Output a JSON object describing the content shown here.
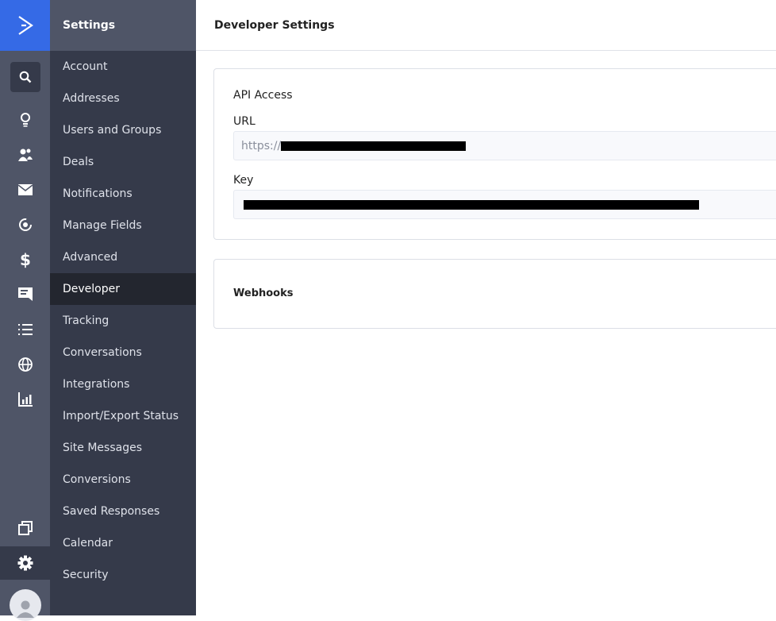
{
  "rail": {
    "icons": [
      "logo-icon",
      "search-icon",
      "lightbulb-icon",
      "contacts-icon",
      "email-icon",
      "automation-icon",
      "dollar-icon",
      "conversations-icon",
      "list-icon",
      "globe-icon",
      "reports-icon",
      "pages-icon",
      "gear-icon",
      "avatar-icon"
    ],
    "accent": "#356ae6"
  },
  "sidebar": {
    "title": "Settings",
    "active": "Developer",
    "items": [
      {
        "label": "Account"
      },
      {
        "label": "Addresses"
      },
      {
        "label": "Users and Groups"
      },
      {
        "label": "Deals"
      },
      {
        "label": "Notifications"
      },
      {
        "label": "Manage Fields"
      },
      {
        "label": "Advanced"
      },
      {
        "label": "Developer"
      },
      {
        "label": "Tracking"
      },
      {
        "label": "Conversations"
      },
      {
        "label": "Integrations"
      },
      {
        "label": "Import/Export Status"
      },
      {
        "label": "Site Messages"
      },
      {
        "label": "Conversions"
      },
      {
        "label": "Saved Responses"
      },
      {
        "label": "Calendar"
      },
      {
        "label": "Security"
      }
    ]
  },
  "header": {
    "title": "Developer Settings"
  },
  "api": {
    "title": "API Access",
    "url_label": "URL",
    "url_value": "https://",
    "key_label": "Key"
  },
  "webhooks": {
    "title": "Webhooks"
  }
}
